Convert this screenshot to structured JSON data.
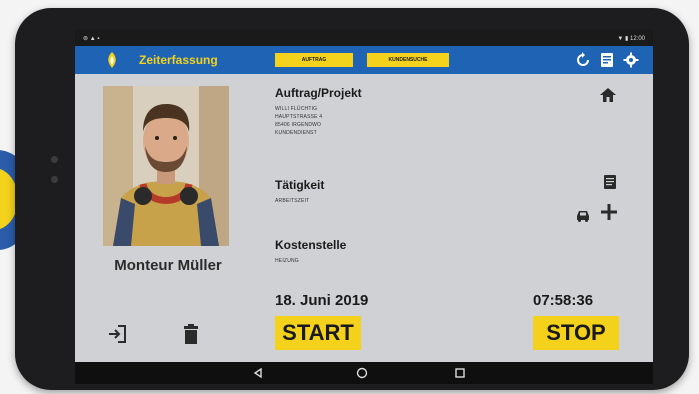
{
  "statusbar": {
    "left_icons": "⊚ ▲ ▪",
    "right_text": "▼ ▮ 12:00"
  },
  "app": {
    "title": "Zeiterfassung",
    "button1": "AUFTRAG",
    "button2": "KUNDENSUCHE",
    "accent": "#1f63b5",
    "yellow": "#f4d21c"
  },
  "employee": {
    "name": "Monteur Müller"
  },
  "auftrag": {
    "title": "Auftrag/Projekt",
    "lines": [
      "WILLI FLÜCHTIG",
      "HAUPTSTRASSE 4",
      "85406 IRGENDWO",
      "KUNDENDIENST"
    ]
  },
  "taetigkeit": {
    "title": "Tätigkeit",
    "value": "ARBEITSZEIT"
  },
  "kostenstelle": {
    "title": "Kostenstelle",
    "value": "HEIZUNG"
  },
  "date": "18. Juni 2019",
  "time": "07:58:36",
  "buttons": {
    "start": "START",
    "stop": "STOP"
  }
}
